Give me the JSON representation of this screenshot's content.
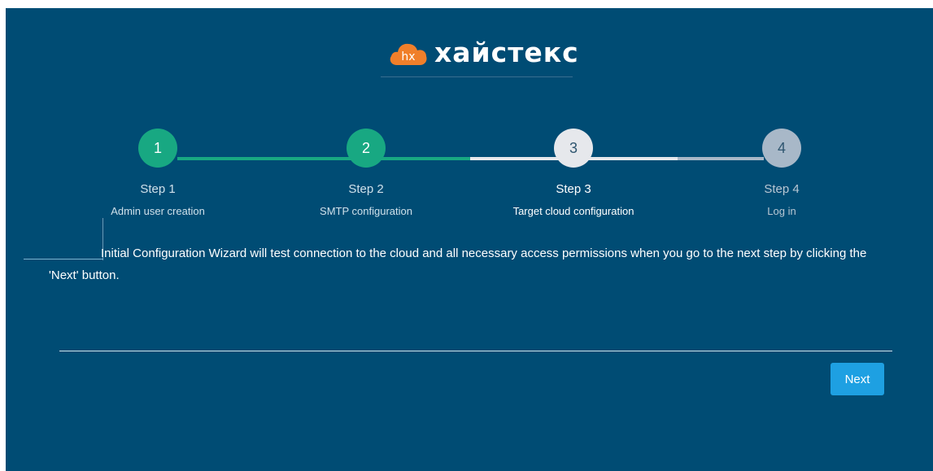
{
  "brand": {
    "name": "хайстекс",
    "badge": "hx"
  },
  "colors": {
    "background": "#004c74",
    "completed": "#18a882",
    "current": "#e6e8ec",
    "upcoming": "#a8b8c8",
    "button": "#1ea0e2"
  },
  "steps": [
    {
      "number": "1",
      "title": "Step 1",
      "subtitle": "Admin user creation",
      "state": "completed"
    },
    {
      "number": "2",
      "title": "Step 2",
      "subtitle": "SMTP configuration",
      "state": "completed"
    },
    {
      "number": "3",
      "title": "Step 3",
      "subtitle": "Target cloud configuration",
      "state": "current"
    },
    {
      "number": "4",
      "title": "Step 4",
      "subtitle": "Log in",
      "state": "upcoming"
    }
  ],
  "message": "Initial Configuration Wizard will test connection to the cloud and all necessary access permissions when you go to the next step by clicking the 'Next' button.",
  "next_button": "Next"
}
